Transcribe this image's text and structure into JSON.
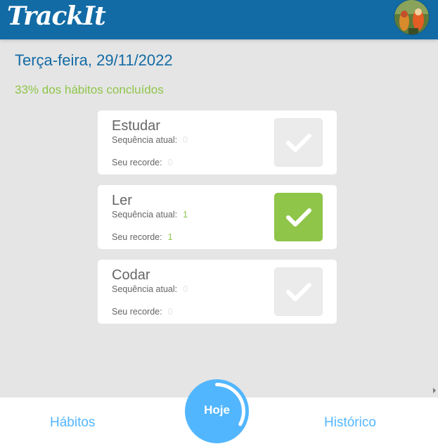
{
  "header": {
    "logo": "TrackIt"
  },
  "today": {
    "date": "Terça-feira, 29/11/2022",
    "progress_text": "33% dos hábitos concluídos",
    "progress_fraction": 0.33
  },
  "habits": [
    {
      "name": "Estudar",
      "streak_label": "Sequência atual:",
      "streak": "0",
      "record_label": "Seu recorde:",
      "record": "0",
      "done": false
    },
    {
      "name": "Ler",
      "streak_label": "Sequência atual:",
      "streak": "1",
      "record_label": "Seu recorde:",
      "record": "1",
      "done": true
    },
    {
      "name": "Codar",
      "streak_label": "Sequência atual:",
      "streak": "0",
      "record_label": "Seu recorde:",
      "record": "0",
      "done": false
    }
  ],
  "footer": {
    "habits_label": "Hábitos",
    "today_label": "Hoje",
    "history_label": "Histórico"
  },
  "colors": {
    "primary": "#126ba5",
    "accent": "#52b6ff",
    "success": "#8fc549",
    "background": "#e5e5e5"
  }
}
